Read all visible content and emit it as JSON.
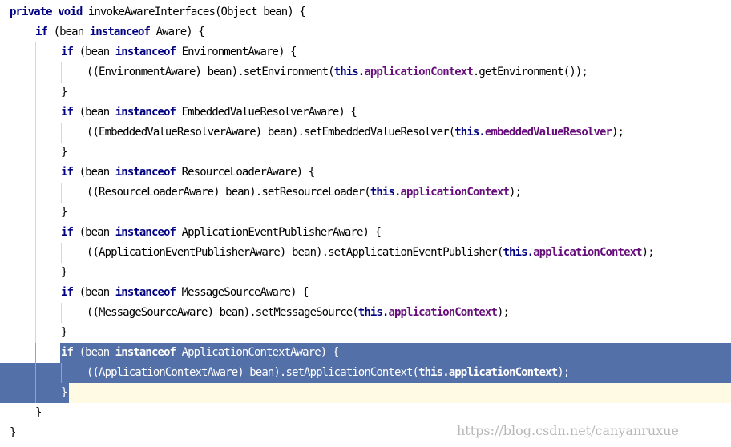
{
  "editor": {
    "lines": [
      {
        "indent": 0,
        "caret_line": false,
        "selected": false,
        "tokens": [
          {
            "t": "private void ",
            "s": "kw"
          },
          {
            "t": "invokeAwareInterfaces(Object bean) {",
            "s": "plain"
          }
        ]
      },
      {
        "indent": 1,
        "caret_line": false,
        "selected": false,
        "tokens": [
          {
            "t": "if ",
            "s": "kw"
          },
          {
            "t": "(bean ",
            "s": "plain"
          },
          {
            "t": "instanceof ",
            "s": "kw"
          },
          {
            "t": "Aware) {",
            "s": "plain"
          }
        ]
      },
      {
        "indent": 2,
        "caret_line": false,
        "selected": false,
        "tokens": [
          {
            "t": "if ",
            "s": "kw"
          },
          {
            "t": "(bean ",
            "s": "plain"
          },
          {
            "t": "instanceof ",
            "s": "kw"
          },
          {
            "t": "EnvironmentAware) {",
            "s": "plain"
          }
        ]
      },
      {
        "indent": 3,
        "caret_line": false,
        "selected": false,
        "tokens": [
          {
            "t": "((EnvironmentAware) bean).setEnvironment(",
            "s": "plain"
          },
          {
            "t": "this.",
            "s": "kw"
          },
          {
            "t": "applicationContext",
            "s": "fld"
          },
          {
            "t": ".getEnvironment());",
            "s": "plain"
          }
        ]
      },
      {
        "indent": 2,
        "caret_line": false,
        "selected": false,
        "tokens": [
          {
            "t": "}",
            "s": "plain"
          }
        ]
      },
      {
        "indent": 2,
        "caret_line": false,
        "selected": false,
        "tokens": [
          {
            "t": "if ",
            "s": "kw"
          },
          {
            "t": "(bean ",
            "s": "plain"
          },
          {
            "t": "instanceof ",
            "s": "kw"
          },
          {
            "t": "EmbeddedValueResolverAware) {",
            "s": "plain"
          }
        ]
      },
      {
        "indent": 3,
        "caret_line": false,
        "selected": false,
        "tokens": [
          {
            "t": "((EmbeddedValueResolverAware) bean).setEmbeddedValueResolver(",
            "s": "plain"
          },
          {
            "t": "this.",
            "s": "kw"
          },
          {
            "t": "embeddedValueResolver",
            "s": "fld"
          },
          {
            "t": ");",
            "s": "plain"
          }
        ]
      },
      {
        "indent": 2,
        "caret_line": false,
        "selected": false,
        "tokens": [
          {
            "t": "}",
            "s": "plain"
          }
        ]
      },
      {
        "indent": 2,
        "caret_line": false,
        "selected": false,
        "tokens": [
          {
            "t": "if ",
            "s": "kw"
          },
          {
            "t": "(bean ",
            "s": "plain"
          },
          {
            "t": "instanceof ",
            "s": "kw"
          },
          {
            "t": "ResourceLoaderAware) {",
            "s": "plain"
          }
        ]
      },
      {
        "indent": 3,
        "caret_line": false,
        "selected": false,
        "tokens": [
          {
            "t": "((ResourceLoaderAware) bean).setResourceLoader(",
            "s": "plain"
          },
          {
            "t": "this.",
            "s": "kw"
          },
          {
            "t": "applicationContext",
            "s": "fld"
          },
          {
            "t": ");",
            "s": "plain"
          }
        ]
      },
      {
        "indent": 2,
        "caret_line": false,
        "selected": false,
        "tokens": [
          {
            "t": "}",
            "s": "plain"
          }
        ]
      },
      {
        "indent": 2,
        "caret_line": false,
        "selected": false,
        "tokens": [
          {
            "t": "if ",
            "s": "kw"
          },
          {
            "t": "(bean ",
            "s": "plain"
          },
          {
            "t": "instanceof ",
            "s": "kw"
          },
          {
            "t": "ApplicationEventPublisherAware) {",
            "s": "plain"
          }
        ]
      },
      {
        "indent": 3,
        "caret_line": false,
        "selected": false,
        "tokens": [
          {
            "t": "((ApplicationEventPublisherAware) bean).setApplicationEventPublisher(",
            "s": "plain"
          },
          {
            "t": "this.",
            "s": "kw"
          },
          {
            "t": "applicationContext",
            "s": "fld"
          },
          {
            "t": ");",
            "s": "plain"
          }
        ]
      },
      {
        "indent": 2,
        "caret_line": false,
        "selected": false,
        "tokens": [
          {
            "t": "}",
            "s": "plain"
          }
        ]
      },
      {
        "indent": 2,
        "caret_line": false,
        "selected": false,
        "tokens": [
          {
            "t": "if ",
            "s": "kw"
          },
          {
            "t": "(bean ",
            "s": "plain"
          },
          {
            "t": "instanceof ",
            "s": "kw"
          },
          {
            "t": "MessageSourceAware) {",
            "s": "plain"
          }
        ]
      },
      {
        "indent": 3,
        "caret_line": false,
        "selected": false,
        "tokens": [
          {
            "t": "((MessageSourceAware) bean).setMessageSource(",
            "s": "plain"
          },
          {
            "t": "this.",
            "s": "kw"
          },
          {
            "t": "applicationContext",
            "s": "fld"
          },
          {
            "t": ");",
            "s": "plain"
          }
        ]
      },
      {
        "indent": 2,
        "caret_line": false,
        "selected": false,
        "tokens": [
          {
            "t": "}",
            "s": "plain"
          }
        ]
      },
      {
        "indent": 2,
        "caret_line": false,
        "selected": true,
        "tokens": [
          {
            "t": "if ",
            "s": "kw"
          },
          {
            "t": "(bean ",
            "s": "plain"
          },
          {
            "t": "instanceof ",
            "s": "kw"
          },
          {
            "t": "ApplicationContextAware) {",
            "s": "plain"
          }
        ]
      },
      {
        "indent": 3,
        "caret_line": false,
        "selected": true,
        "tokens": [
          {
            "t": "((ApplicationContextAware) bean).setApplicationContext(",
            "s": "plain"
          },
          {
            "t": "this.",
            "s": "kw"
          },
          {
            "t": "applicationContext",
            "s": "fld"
          },
          {
            "t": ");",
            "s": "plain"
          }
        ]
      },
      {
        "indent": 2,
        "caret_line": true,
        "selected": true,
        "tokens": [
          {
            "t": "}",
            "s": "plain"
          }
        ]
      },
      {
        "indent": 1,
        "caret_line": false,
        "selected": false,
        "tokens": [
          {
            "t": "}",
            "s": "plain"
          }
        ]
      },
      {
        "indent": 0,
        "caret_line": false,
        "selected": false,
        "tokens": [
          {
            "t": "}",
            "s": "plain"
          }
        ]
      }
    ]
  },
  "watermark": {
    "text": "https://blog.csdn.net/canyanruxue"
  },
  "colors": {
    "keyword": "#000080",
    "field": "#660e7a",
    "selection": "#5470a8",
    "caret_line": "#fffae3",
    "watermark": "#b8b8b8"
  }
}
